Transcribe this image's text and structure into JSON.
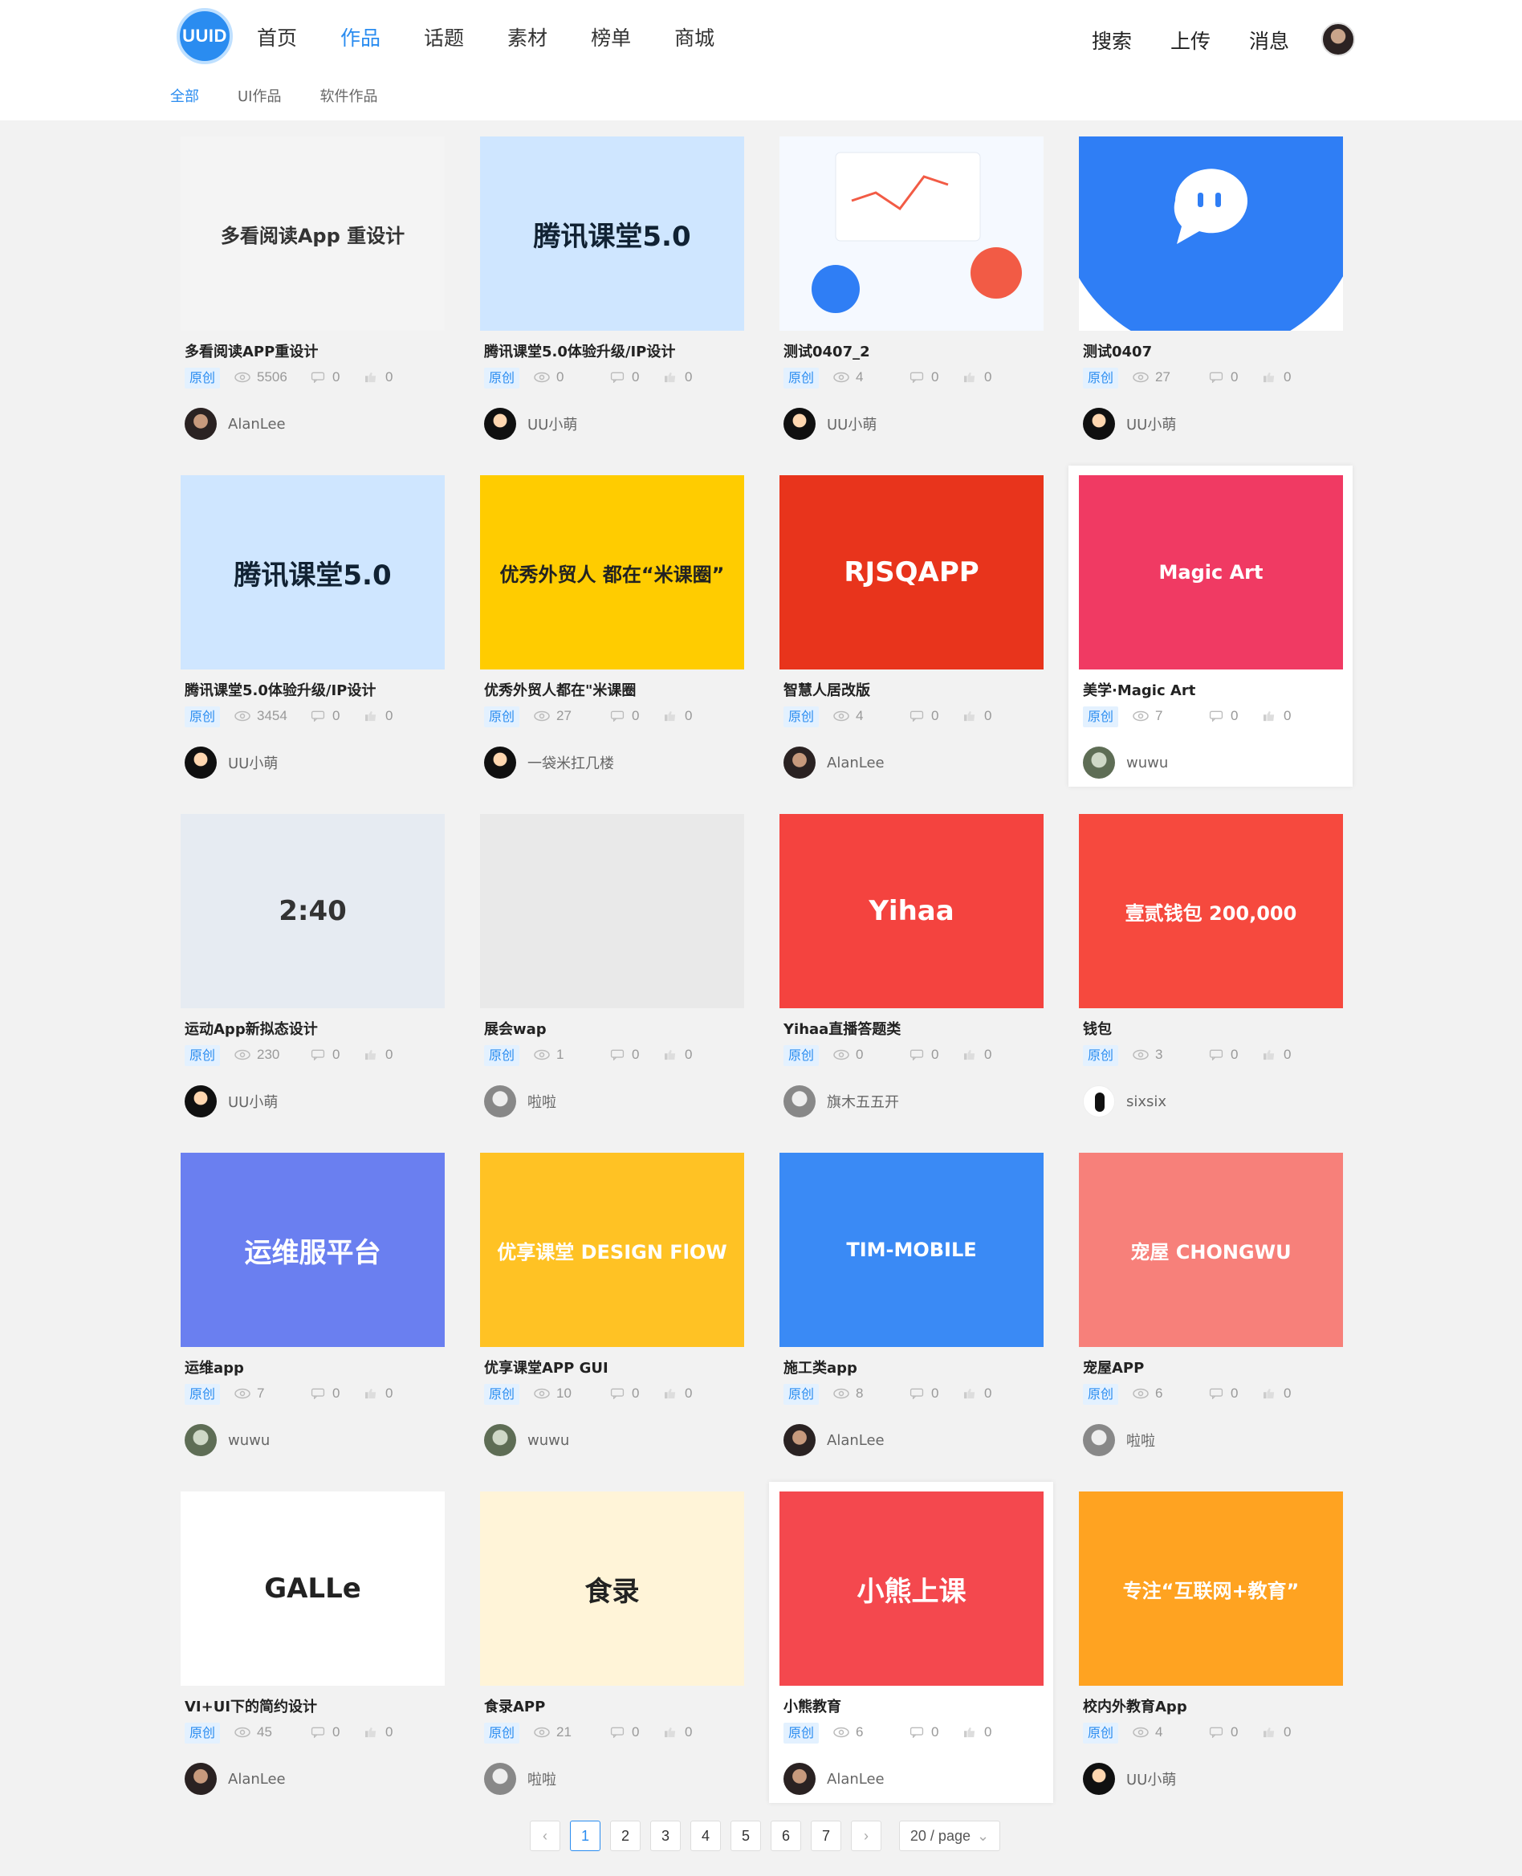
{
  "header": {
    "logo": "UUID",
    "nav": [
      "首页",
      "作品",
      "话题",
      "素材",
      "榜单",
      "商城"
    ],
    "active_nav": "作品",
    "right": {
      "search": "搜索",
      "upload": "上传",
      "messages": "消息"
    }
  },
  "subnav": [
    "全部",
    "UI作品",
    "软件作品"
  ],
  "badge_label": "原创",
  "cards": [
    {
      "title": "多看阅读APP重设计",
      "views": "5506",
      "comments": "0",
      "likes": "0",
      "author": "AlanLee",
      "thumb_text": "多看阅读App 重设计",
      "thumb_bg": "#f4f4f4",
      "thumb_fg": "#333"
    },
    {
      "title": "腾讯课堂5.0体验升级/IP设计",
      "views": "0",
      "comments": "0",
      "likes": "0",
      "author": "UU小萌",
      "thumb_text": "腾讯课堂5.0",
      "thumb_bg": "#cfe6ff",
      "thumb_fg": "#123"
    },
    {
      "title": "测试0407_2",
      "views": "4",
      "comments": "0",
      "likes": "0",
      "author": "UU小萌",
      "thumb_text": "",
      "thumb_bg": "#f5f9ff",
      "thumb_fg": "#333"
    },
    {
      "title": "测试0407",
      "views": "27",
      "comments": "0",
      "likes": "0",
      "author": "UU小萌",
      "thumb_text": "",
      "thumb_bg": "#ffffff",
      "thumb_fg": "#fff"
    },
    {
      "title": "腾讯课堂5.0体验升级/IP设计",
      "views": "3454",
      "comments": "0",
      "likes": "0",
      "author": "UU小萌",
      "thumb_text": "腾讯课堂5.0",
      "thumb_bg": "#cfe6ff",
      "thumb_fg": "#123"
    },
    {
      "title": "优秀外贸人都在\"米课圈",
      "views": "27",
      "comments": "0",
      "likes": "0",
      "author": "一袋米扛几楼",
      "thumb_text": "优秀外贸人 都在“米课圈”",
      "thumb_bg": "#ffcc00",
      "thumb_fg": "#222"
    },
    {
      "title": "智慧人居改版",
      "views": "4",
      "comments": "0",
      "likes": "0",
      "author": "AlanLee",
      "thumb_text": "RJSQAPP",
      "thumb_bg": "#e8341c",
      "thumb_fg": "#fff"
    },
    {
      "title": "美学·Magic Art",
      "views": "7",
      "comments": "0",
      "likes": "0",
      "author": "wuwu",
      "thumb_text": "Magic Art",
      "thumb_bg": "#f03a63",
      "thumb_fg": "#fff"
    },
    {
      "title": "运动App新拟态设计",
      "views": "230",
      "comments": "0",
      "likes": "0",
      "author": "UU小萌",
      "thumb_text": "2:40",
      "thumb_bg": "#e6ebf2",
      "thumb_fg": "#333"
    },
    {
      "title": "展会wap",
      "views": "1",
      "comments": "0",
      "likes": "0",
      "author": "啦啦",
      "thumb_text": "",
      "thumb_bg": "#e9e9e9",
      "thumb_fg": "#333"
    },
    {
      "title": "Yihaa直播答题类",
      "views": "0",
      "comments": "0",
      "likes": "0",
      "author": "旗木五五开",
      "thumb_text": "Yihaa",
      "thumb_bg": "#f4433f",
      "thumb_fg": "#fff"
    },
    {
      "title": "钱包",
      "views": "3",
      "comments": "0",
      "likes": "0",
      "author": "sixsix",
      "thumb_text": "壹贰钱包 200,000",
      "thumb_bg": "#f6493e",
      "thumb_fg": "#fff"
    },
    {
      "title": "运维app",
      "views": "7",
      "comments": "0",
      "likes": "0",
      "author": "wuwu",
      "thumb_text": "运维服平台",
      "thumb_bg": "#6a7ff0",
      "thumb_fg": "#fff"
    },
    {
      "title": "优享课堂APP GUI",
      "views": "10",
      "comments": "0",
      "likes": "0",
      "author": "wuwu",
      "thumb_text": "优享课堂 DESIGN FlOW",
      "thumb_bg": "#ffc224",
      "thumb_fg": "#fff"
    },
    {
      "title": "施工类app",
      "views": "8",
      "comments": "0",
      "likes": "0",
      "author": "AlanLee",
      "thumb_text": "TIM-MOBILE",
      "thumb_bg": "#3a8af5",
      "thumb_fg": "#fff"
    },
    {
      "title": "宠屋APP",
      "views": "6",
      "comments": "0",
      "likes": "0",
      "author": "啦啦",
      "thumb_text": "宠屋 CHONGWU",
      "thumb_bg": "#f7807a",
      "thumb_fg": "#fff"
    },
    {
      "title": "VI+UI下的简约设计",
      "views": "45",
      "comments": "0",
      "likes": "0",
      "author": "AlanLee",
      "thumb_text": "GALLe",
      "thumb_bg": "#ffffff",
      "thumb_fg": "#222"
    },
    {
      "title": "食录APP",
      "views": "21",
      "comments": "0",
      "likes": "0",
      "author": "啦啦",
      "thumb_text": "食录",
      "thumb_bg": "#fff4d8",
      "thumb_fg": "#222"
    },
    {
      "title": "小熊教育",
      "views": "6",
      "comments": "0",
      "likes": "0",
      "author": "AlanLee",
      "thumb_text": "小熊上课",
      "thumb_bg": "#f4484e",
      "thumb_fg": "#fff"
    },
    {
      "title": "校内外教育App",
      "views": "4",
      "comments": "0",
      "likes": "0",
      "author": "UU小萌",
      "thumb_text": "专注“互联网+教育”",
      "thumb_bg": "#ffa321",
      "thumb_fg": "#fff"
    }
  ],
  "pagination": {
    "pages": [
      "1",
      "2",
      "3",
      "4",
      "5",
      "6",
      "7"
    ],
    "current": "1",
    "page_size": "20 / page"
  },
  "colors": {
    "accent": "#2a8cf0",
    "background": "#f2f2f2"
  }
}
